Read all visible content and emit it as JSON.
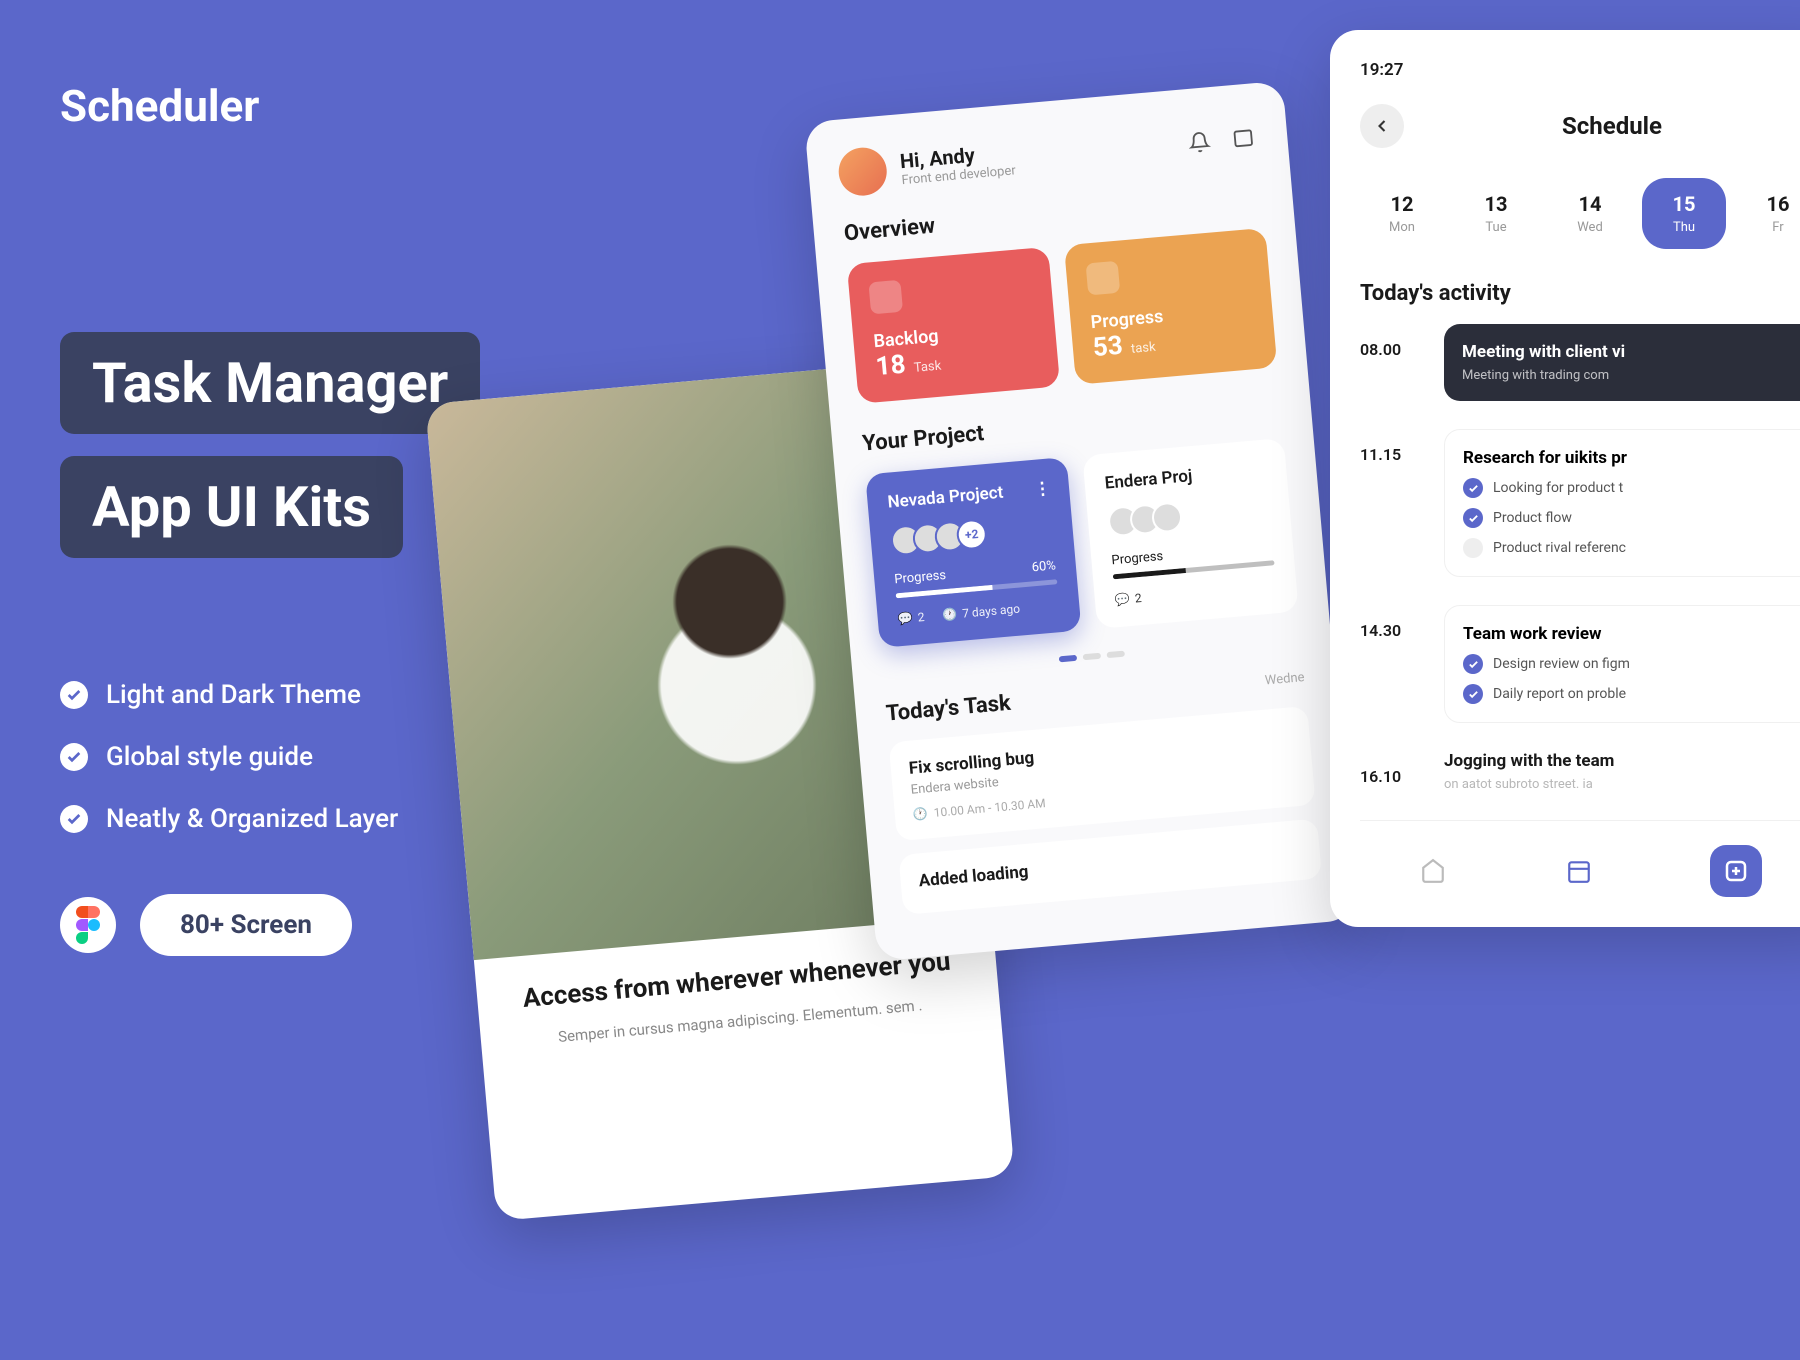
{
  "brand": "Scheduler",
  "headlines": {
    "line1": "Task Manager",
    "line2": "App UI Kits"
  },
  "features": [
    "Light and Dark Theme",
    "Global style guide",
    "Neatly & Organized Layer"
  ],
  "badge": "80+ Screen",
  "onboard": {
    "title": "Access from wherever\nwhenever you",
    "sub": "Semper in cursus magna adipiscing. Elementum. sem ."
  },
  "home": {
    "greeting": "Hi, Andy",
    "role": "Front end developer",
    "overview_h": "Overview",
    "cards": [
      {
        "label": "Backlog",
        "count": "18",
        "unit": "Task"
      },
      {
        "label": "Progress",
        "count": "53",
        "unit": "task"
      }
    ],
    "project_h": "Your Project",
    "projects": [
      {
        "title": "Nevada Project",
        "progress_lbl": "Progress",
        "progress": "60%",
        "extra": "+2",
        "comments": "2",
        "date": "7 days ago"
      },
      {
        "title": "Endera Proj",
        "progress_lbl": "Progress",
        "comments": "2"
      }
    ],
    "task_h": "Today's Task",
    "task_day": "Wedne",
    "tasks": [
      {
        "t": "Fix scrolling bug",
        "s": "Endera website",
        "time": "10.00 Am - 10.30 AM"
      },
      {
        "t": "Added loading",
        "s": "",
        "time": ""
      }
    ]
  },
  "sched": {
    "time": "19:27",
    "title": "Schedule",
    "days": [
      {
        "n": "12",
        "l": "Mon"
      },
      {
        "n": "13",
        "l": "Tue"
      },
      {
        "n": "14",
        "l": "Wed"
      },
      {
        "n": "15",
        "l": "Thu"
      },
      {
        "n": "16",
        "l": "Fr"
      }
    ],
    "activity_h": "Today's activity",
    "acts": [
      {
        "time": "08.00",
        "t": "Meeting with client vi",
        "s": "Meeting with trading com",
        "dark": true
      },
      {
        "time": "11.15",
        "t": "Research for uikits pr",
        "items": [
          "Looking for product t",
          "Product flow",
          "Product rival referenc"
        ],
        "checked": [
          true,
          true,
          false
        ]
      },
      {
        "time": "14.30",
        "t": "Team work review",
        "items": [
          "Design review on figm",
          "Daily report on proble"
        ],
        "checked": [
          true,
          true
        ]
      },
      {
        "time": "16.10",
        "t": "Jogging with the team",
        "s": "on aatot subroto street. ia"
      }
    ]
  }
}
